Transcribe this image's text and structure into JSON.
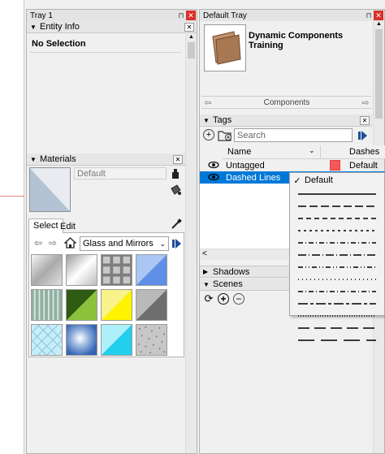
{
  "tray1": {
    "title": "Tray 1",
    "entity_info": {
      "header": "Entity Info",
      "value": "No Selection"
    },
    "materials": {
      "header": "Materials",
      "current_name": "Default",
      "tabs": [
        "Select",
        "Edit"
      ],
      "library": "Glass and Mirrors"
    }
  },
  "default_tray": {
    "title": "Default Tray",
    "components": {
      "title": "Dynamic Components Training",
      "nav_label": "Components"
    },
    "tags": {
      "header": "Tags",
      "search_placeholder": "Search",
      "columns": {
        "name": "Name",
        "dashes": "Dashes"
      },
      "rows": [
        {
          "name": "Untagged",
          "color": "#f25a5a",
          "dash": "Default"
        },
        {
          "name": "Dashed Lines",
          "color": "#ffffff",
          "dash": ""
        }
      ]
    },
    "shadows": {
      "header": "Shadows"
    },
    "scenes": {
      "header": "Scenes"
    }
  },
  "dash_menu": {
    "selected_check": "✓",
    "default_label": "Default",
    "patterns": [
      "solid",
      "long-dash",
      "dash",
      "short-dash",
      "dash-dot",
      "long-dash-dot",
      "dash-dot-dot",
      "dot",
      "dash-dot",
      "long-dash-dash",
      "dense-dot",
      "long-dash-gap",
      "sparse-long"
    ]
  }
}
